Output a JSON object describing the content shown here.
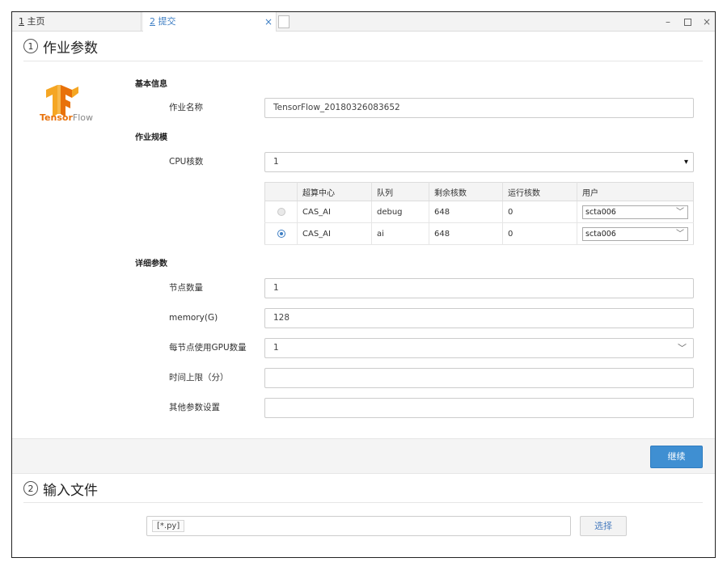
{
  "tabs": [
    {
      "num": "1",
      "label": "主页"
    },
    {
      "num": "2",
      "label": "提交"
    }
  ],
  "tab_close_glyph": "×",
  "window_controls": {
    "minimize": "–",
    "close": "×"
  },
  "section1": {
    "num": "1",
    "title": "作业参数"
  },
  "logo": {
    "brand_bold": "Tensor",
    "brand_light": "Flow",
    "icon": "tensorflow-logo-icon"
  },
  "basic_info": {
    "title": "基本信息",
    "job_name_label": "作业名称",
    "job_name_value": "TensorFlow_20180326083652"
  },
  "job_scale": {
    "title": "作业规模",
    "cpu_label": "CPU核数",
    "cpu_value": "1",
    "cpu_caret": "▾"
  },
  "queue_table": {
    "headers": [
      "超算中心",
      "队列",
      "剩余核数",
      "运行核数",
      "用户"
    ],
    "rows": [
      {
        "selected": false,
        "center": "CAS_AI",
        "queue": "debug",
        "free": "648",
        "running": "0",
        "user": "scta006"
      },
      {
        "selected": true,
        "center": "CAS_AI",
        "queue": "ai",
        "free": "648",
        "running": "0",
        "user": "scta006"
      }
    ]
  },
  "details": {
    "title": "详细参数",
    "nodes_label": "节点数量",
    "nodes_value": "1",
    "memory_label": "memory(G)",
    "memory_value": "128",
    "gpu_label": "每节点使用GPU数量",
    "gpu_value": "1",
    "time_label": "时间上限（分）",
    "time_value": "",
    "other_label": "其他参数设置",
    "other_value": ""
  },
  "continue_button": "继续",
  "section2": {
    "num": "2",
    "title": "输入文件"
  },
  "file": {
    "chip": "[*.py]",
    "choose_button": "选择"
  },
  "colors": {
    "accent": "#3f8fd2",
    "tab_active_text": "#3f7fc4",
    "logo_orange": "#e8710a"
  }
}
